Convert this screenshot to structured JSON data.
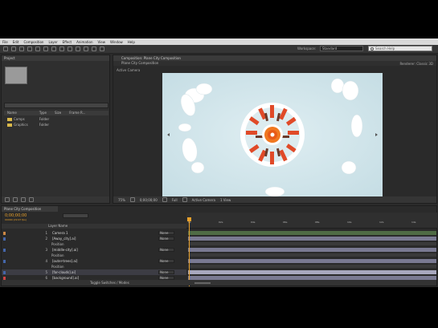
{
  "menubar": {
    "items": [
      "File",
      "Edit",
      "Composition",
      "Layer",
      "Effect",
      "Animation",
      "View",
      "Window",
      "Help"
    ]
  },
  "toolbar": {
    "workspace_label": "Workspace:",
    "workspace_value": "Standard",
    "search_placeholder": "Search Help"
  },
  "project": {
    "tab": "Project",
    "search_value": "",
    "columns": [
      "Name",
      "Type",
      "Size",
      "Frame R..."
    ],
    "rows": [
      {
        "name": "Comps",
        "type": "Folder"
      },
      {
        "name": "Graphics",
        "type": "Folder"
      }
    ]
  },
  "composition": {
    "tab": "Composition: Plane City Composition",
    "sub_tab": "Plane City Composition",
    "renderer": "Renderer: Classic 3D",
    "active_camera": "Active Camera",
    "footer": {
      "zoom": "75%",
      "timecode": "0;00;00;00",
      "resolution": "Full",
      "view": "Active Camera",
      "views": "1 View"
    }
  },
  "timeline": {
    "tab": "Plane City Composition",
    "timecode": "0;00;00;00",
    "fps_note": "00000 (29.97 fps)",
    "columns": "Layer Name",
    "ruler_ticks": [
      "0s",
      "02s",
      "04s",
      "06s",
      "08s",
      "10s",
      "12s",
      "14s"
    ],
    "layers": [
      {
        "num": "1",
        "name": "Camera 1",
        "mode": "",
        "parent": "None",
        "color": "#cc8844"
      },
      {
        "num": "2",
        "name": "[Away_city].ai]",
        "mode": "",
        "parent": "None",
        "color": "#4466aa"
      },
      {
        "num": "3",
        "name": "[middle-city].ai]",
        "mode": "",
        "parent": "None",
        "color": "#4466aa"
      },
      {
        "num": "4",
        "name": "[outer-trees].ai]",
        "mode": "",
        "parent": "None",
        "color": "#4466aa"
      },
      {
        "num": "5",
        "name": "[far-clouds].ai]",
        "mode": "",
        "parent": "None",
        "color": "#4466aa"
      },
      {
        "num": "6",
        "name": "[background].ai]",
        "mode": "",
        "parent": "None",
        "color": "#cc4444"
      }
    ],
    "sub_label": "Position",
    "footer": "Toggle Switches / Modes"
  },
  "colors": {
    "accent": "#e8a02a",
    "sun": "#f07820",
    "city": "#e04a28",
    "cloud": "#ffffff"
  }
}
